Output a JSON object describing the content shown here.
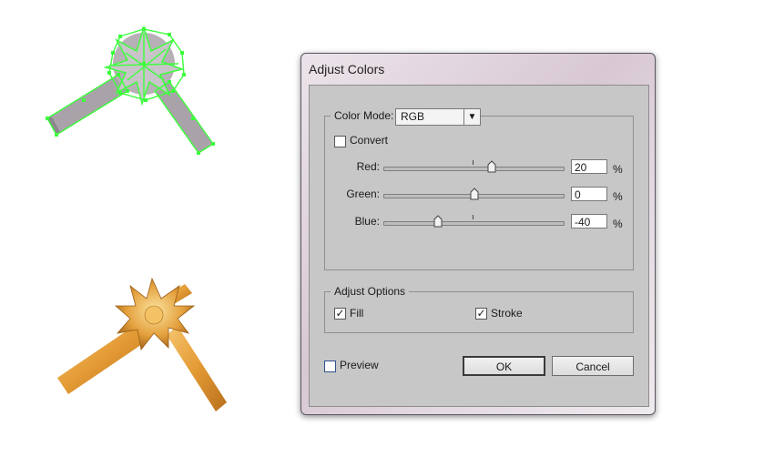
{
  "dialog": {
    "title": "Adjust Colors",
    "color_mode": {
      "label": "Color Mode:",
      "value": "RGB"
    },
    "convert": {
      "label": "Convert",
      "checked": false
    },
    "sliders": [
      {
        "label": "Red:",
        "value": "20",
        "unit": "%",
        "level": 20
      },
      {
        "label": "Green:",
        "value": "0",
        "unit": "%",
        "level": 0
      },
      {
        "label": "Blue:",
        "value": "-40",
        "unit": "%",
        "level": -40
      }
    ],
    "adjust_options": {
      "label": "Adjust Options",
      "fill": {
        "label": "Fill",
        "checked": true
      },
      "stroke": {
        "label": "Stroke",
        "checked": true
      }
    },
    "preview": {
      "label": "Preview",
      "checked": false
    },
    "ok_label": "OK",
    "cancel_label": "Cancel"
  },
  "icons": {
    "dropdown": "chevron-down-icon",
    "check": "checkmark-icon"
  },
  "colors": {
    "selection_green": "#3cff3c",
    "ribbon_gray": "#a9a3a9",
    "ribbon_gold": "#e9a642"
  }
}
